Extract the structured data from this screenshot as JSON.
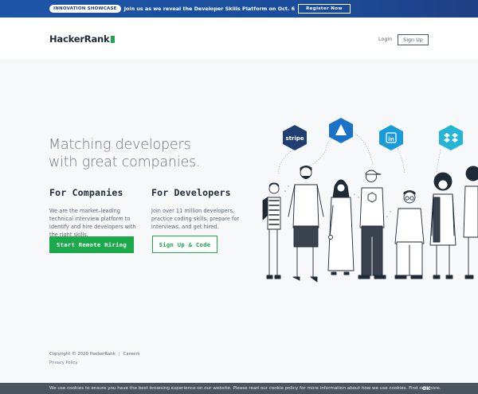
{
  "banner": {
    "badge": "INNOVATION SHOWCASE",
    "text": "Join us as we reveal the Developer Skills Platform on Oct. 6",
    "button": "Register Now"
  },
  "header": {
    "logo": "HackerRank",
    "login": "Login",
    "signup": "Sign Up"
  },
  "hero": {
    "title_line1": "Matching developers",
    "title_line2": "with great companies."
  },
  "companies": {
    "title": "For Companies",
    "text": "We are the market–leading technical interview platform to identify and hire developers with the right skills.",
    "button": "Start Remote Hiring"
  },
  "developers": {
    "title": "For Developers",
    "text": "Join over 11 million developers, practice coding skills, prepare for interviews, and get hired.",
    "button": "Sign Up & Code"
  },
  "logos": {
    "stripe": "stripe"
  },
  "footer": {
    "copyright": "Copyright © 2020 HackerRank",
    "separator": "|",
    "careers": "Careers",
    "privacy": "Privacy Policy"
  },
  "cookie": {
    "text": "We use cookies to ensure you have the best browsing experience on our website. Please read our cookie policy for more information about how we use cookies. Find out more.",
    "ok": "OK"
  },
  "colors": {
    "brand_green": "#1ba94c",
    "banner_blue": "#1e55a8",
    "hex_navy": "#1f3f72",
    "hex_blue": "#1a73c7",
    "hex_cyan": "#1a9ad6",
    "hex_teal": "#24b5d4"
  }
}
